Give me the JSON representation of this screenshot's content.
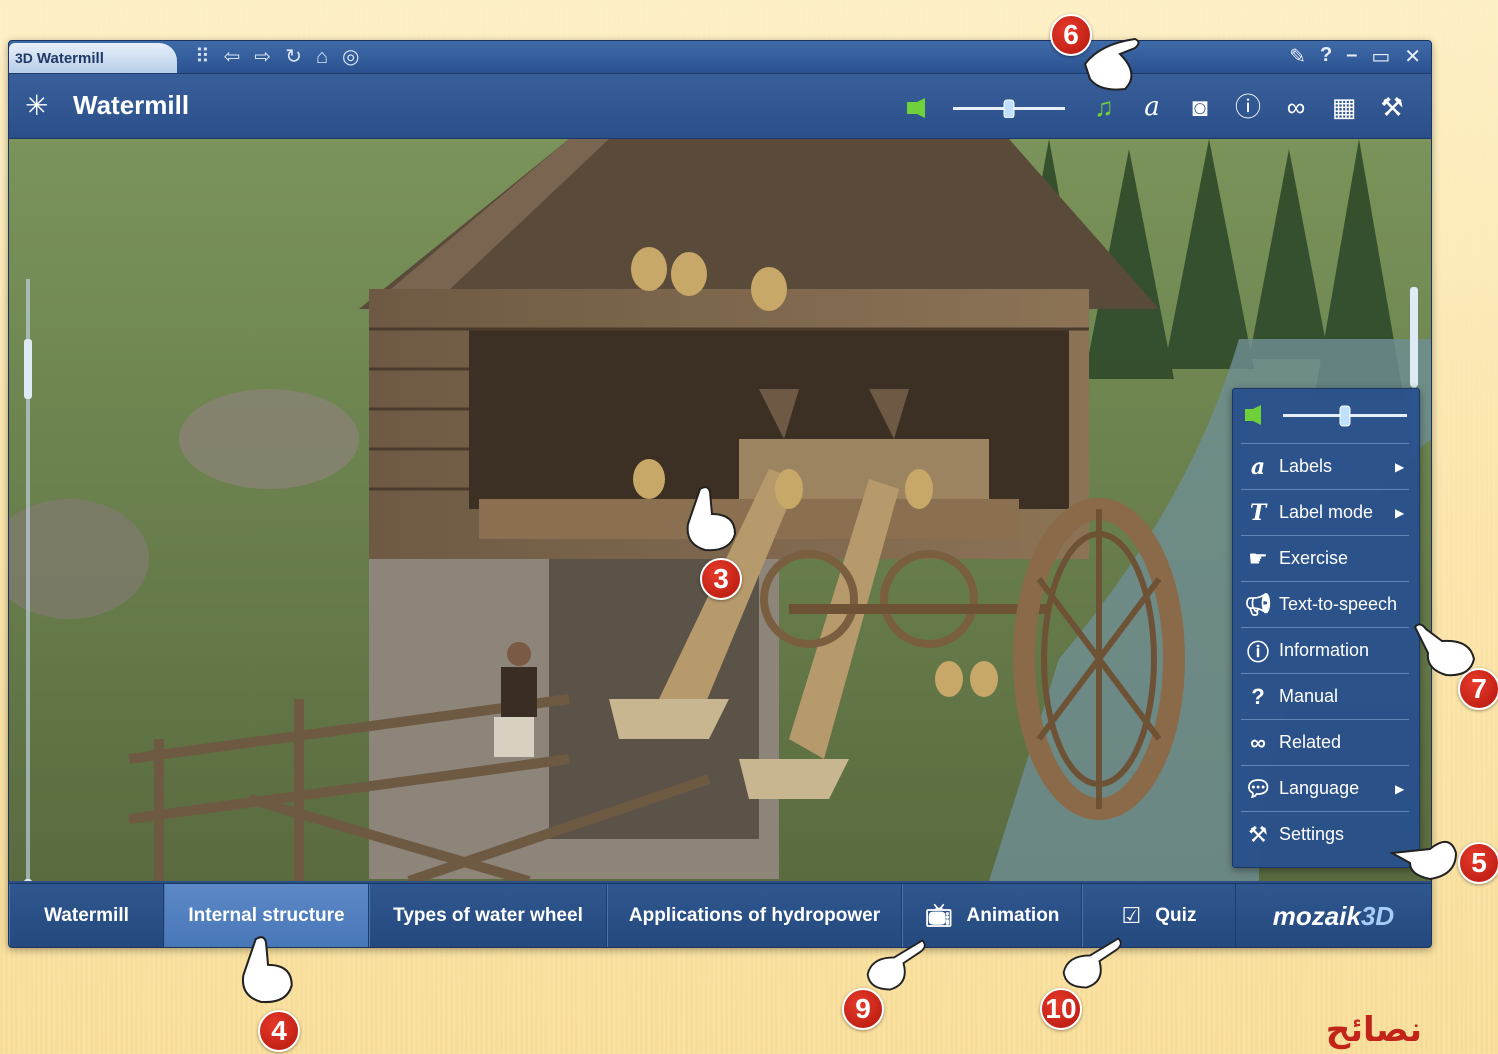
{
  "window": {
    "tab_label": "Watermill",
    "tab_logo": "3D",
    "nav_icons": [
      "grid-icon",
      "back-arrow-icon",
      "forward-arrow-icon",
      "refresh-icon",
      "home-icon",
      "help-globe-icon"
    ],
    "controls": [
      "pin-icon",
      "help-icon",
      "minimize-icon",
      "maximize-icon",
      "close-icon"
    ]
  },
  "toolbar": {
    "title": "Watermill",
    "volume_level": 0.5,
    "icons": [
      "music-icon",
      "labels-icon",
      "camera-icon",
      "info-icon",
      "related-icon",
      "layout-icon",
      "settings-icon"
    ]
  },
  "menu": {
    "volume_level": 0.5,
    "items": [
      {
        "label": "Labels",
        "icon": "labels-icon",
        "submenu": true
      },
      {
        "label": "Label mode",
        "icon": "label-mode-icon",
        "submenu": true
      },
      {
        "label": "Exercise",
        "icon": "exercise-icon",
        "submenu": false
      },
      {
        "label": "Text-to-speech",
        "icon": "speech-icon",
        "submenu": false
      },
      {
        "label": "Information",
        "icon": "info-icon",
        "submenu": false
      },
      {
        "label": "Manual",
        "icon": "manual-icon",
        "submenu": false
      },
      {
        "label": "Related",
        "icon": "related-icon",
        "submenu": false
      },
      {
        "label": "Language",
        "icon": "language-icon",
        "submenu": true
      },
      {
        "label": "Settings",
        "icon": "settings-icon",
        "submenu": false
      }
    ]
  },
  "bottom": {
    "tabs": [
      {
        "label": "Watermill",
        "active": false
      },
      {
        "label": "Internal structure",
        "active": true
      },
      {
        "label": "Types of water wheel",
        "active": false
      },
      {
        "label": "Applications of hydropower",
        "active": false
      },
      {
        "label": "Animation",
        "active": false,
        "icon": "tv-icon"
      },
      {
        "label": "Quiz",
        "active": false,
        "icon": "quiz-icon"
      }
    ],
    "brand_main": "mozaik",
    "brand_3d": "3D"
  },
  "callouts": [
    "3",
    "4",
    "5",
    "6",
    "7",
    "9",
    "10"
  ],
  "footer_text": "نصائح",
  "colors": {
    "accent": "#2c4f86",
    "badge": "#c8241a",
    "music_green": "#6fd13a"
  }
}
